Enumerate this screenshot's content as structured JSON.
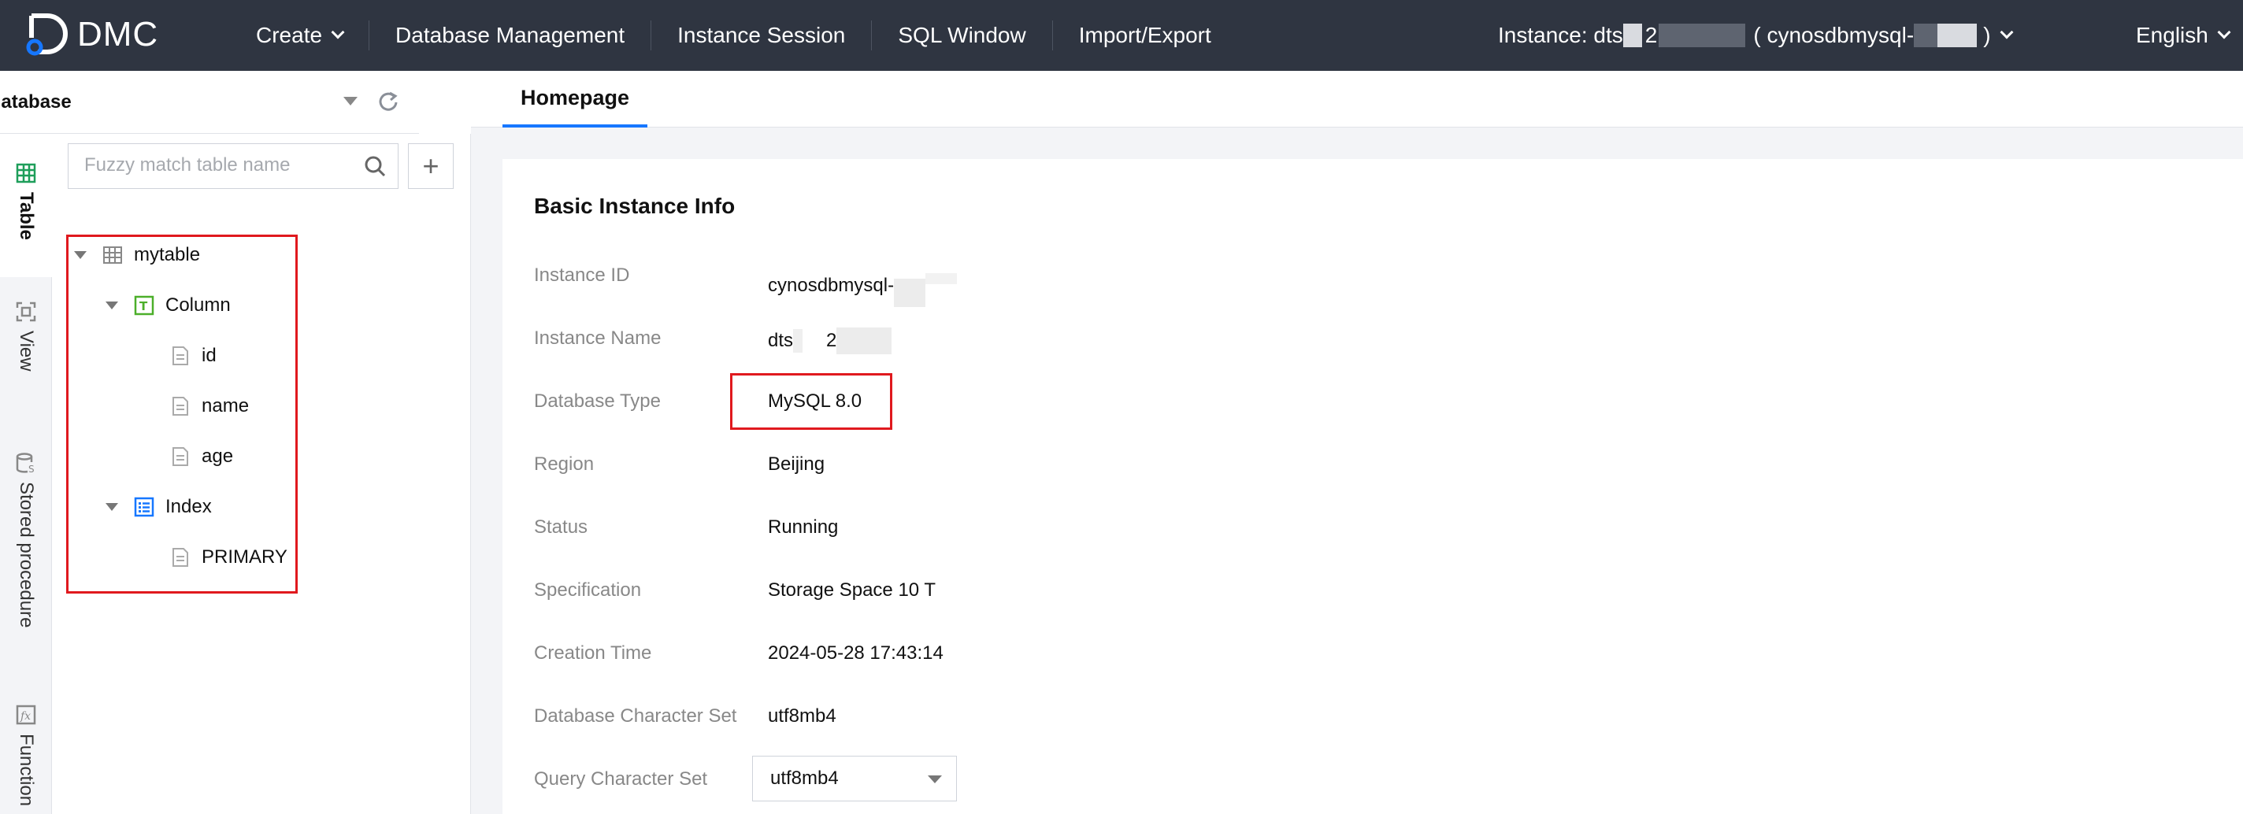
{
  "app": {
    "logo_text": "DMC"
  },
  "nav": {
    "items": [
      {
        "label": "Create",
        "has_dropdown": true
      },
      {
        "label": "Database Management",
        "has_dropdown": false
      },
      {
        "label": "Instance Session",
        "has_dropdown": false
      },
      {
        "label": "SQL Window",
        "has_dropdown": false
      },
      {
        "label": "Import/Export",
        "has_dropdown": false
      }
    ],
    "instance": {
      "prefix": "Instance: dts",
      "mid": "2",
      "paren_open": "( cynosdbmysql-",
      "paren_close": ")"
    },
    "language": "English"
  },
  "sidebar": {
    "database": "mydatabase",
    "search_placeholder": "Fuzzy match table name",
    "add_label": "+",
    "rail_tabs": [
      {
        "label": "Table",
        "icon": "table-icon",
        "active": true
      },
      {
        "label": "View",
        "icon": "view-icon",
        "active": false
      },
      {
        "label": "Stored procedure",
        "icon": "stored-procedure-icon",
        "active": false
      },
      {
        "label": "Function",
        "icon": "function-icon",
        "active": false
      }
    ],
    "tree": {
      "table": "mytable",
      "column_group": "Column",
      "columns": [
        "id",
        "name",
        "age"
      ],
      "index_group": "Index",
      "indexes": [
        "PRIMARY"
      ]
    }
  },
  "main": {
    "tab": "Homepage",
    "card_title": "Basic Instance Info",
    "rows": [
      {
        "label": "Instance ID",
        "value": "cynosdbmysql-"
      },
      {
        "label": "Instance Name",
        "value": "dts",
        "value2": "2"
      },
      {
        "label": "Database Type",
        "value": "MySQL 8.0"
      },
      {
        "label": "Region",
        "value": "Beijing"
      },
      {
        "label": "Status",
        "value": "Running"
      },
      {
        "label": "Specification",
        "value": "Storage Space 10 T"
      },
      {
        "label": "Creation Time",
        "value": "2024-05-28 17:43:14"
      },
      {
        "label": "Database Character Set",
        "value": "utf8mb4"
      },
      {
        "label": "Query Character Set",
        "value": "utf8mb4"
      }
    ]
  },
  "colors": {
    "topbar": "#2f3541",
    "accent": "#1677ff",
    "highlight": "#e0191e",
    "table_icon_green": "#1e9e5a",
    "column_icon_green": "#4caf2a",
    "index_icon_blue": "#1677ff"
  }
}
